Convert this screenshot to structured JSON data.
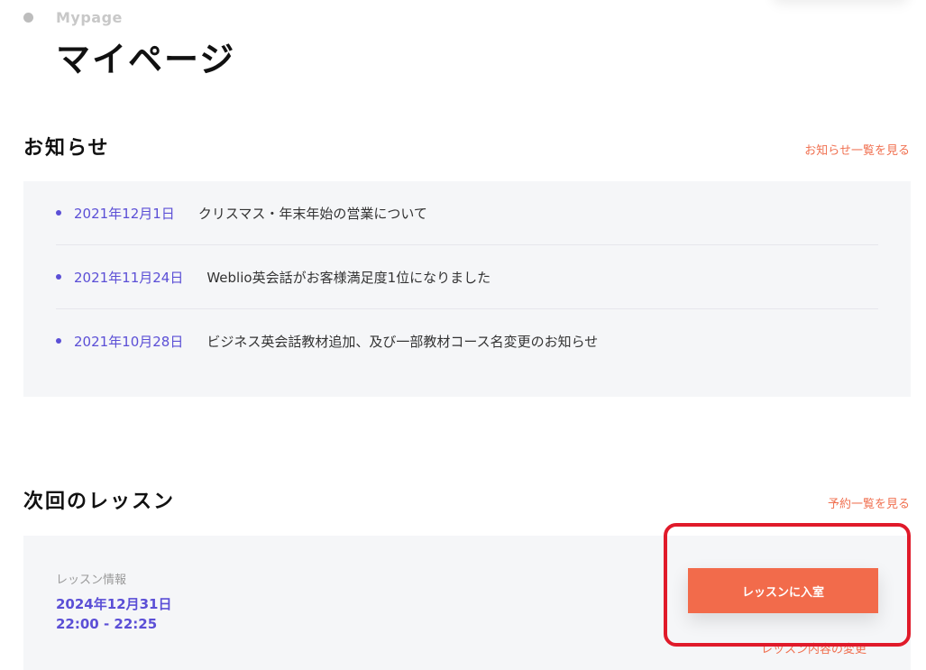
{
  "header": {
    "eyebrow": "Mypage",
    "title": "マイページ"
  },
  "news": {
    "title": "お知らせ",
    "view_all": "お知らせ一覧を見る",
    "items": [
      {
        "date": "2021年12月1日",
        "text": "クリスマス・年末年始の営業について"
      },
      {
        "date": "2021年11月24日",
        "text": "Weblio英会話がお客様満足度1位になりました"
      },
      {
        "date": "2021年10月28日",
        "text": "ビジネス英会話教材追加、及び一部教材コース名変更のお知らせ"
      }
    ]
  },
  "lesson": {
    "title": "次回のレッスン",
    "view_all": "予約一覧を見る",
    "info_label": "レッスン情報",
    "date": "2024年12月31日",
    "time": "22:00 - 22:25",
    "enter_label": "レッスンに入室",
    "change_label": "レッスン内容の変更"
  },
  "colors": {
    "accent": "#f26b4b",
    "link": "#f07050",
    "date": "#5b4fd6",
    "highlight": "#e01a2a"
  }
}
